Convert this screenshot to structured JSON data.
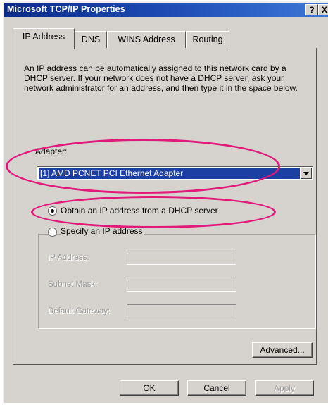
{
  "window": {
    "title": "Microsoft TCP/IP Properties",
    "help_button": "?",
    "close_button": "X"
  },
  "tabs": [
    {
      "label": "IP Address",
      "active": true
    },
    {
      "label": "DNS",
      "active": false
    },
    {
      "label": "WINS Address",
      "active": false
    },
    {
      "label": "Routing",
      "active": false
    }
  ],
  "description": "An IP address can be automatically assigned to this network card by a DHCP server.  If your network does not have a DHCP server, ask your network administrator for an address, and then type it in the space below.",
  "adapter": {
    "label": "Adapter:",
    "selected": "[1] AMD PCNET PCI Ethernet Adapter"
  },
  "options": {
    "dhcp_label": "Obtain an IP address from a DHCP server",
    "specify_label": "Specify an IP address",
    "selected": "dhcp"
  },
  "fields": {
    "ip_address_label": "IP Address:",
    "subnet_mask_label": "Subnet Mask:",
    "default_gateway_label": "Default Gateway:"
  },
  "buttons": {
    "advanced": "Advanced...",
    "ok": "OK",
    "cancel": "Cancel",
    "apply": "Apply"
  },
  "colors": {
    "highlight": "#e0197a",
    "title_bar": "#0a2a8a",
    "selection": "#1c3fa4"
  }
}
